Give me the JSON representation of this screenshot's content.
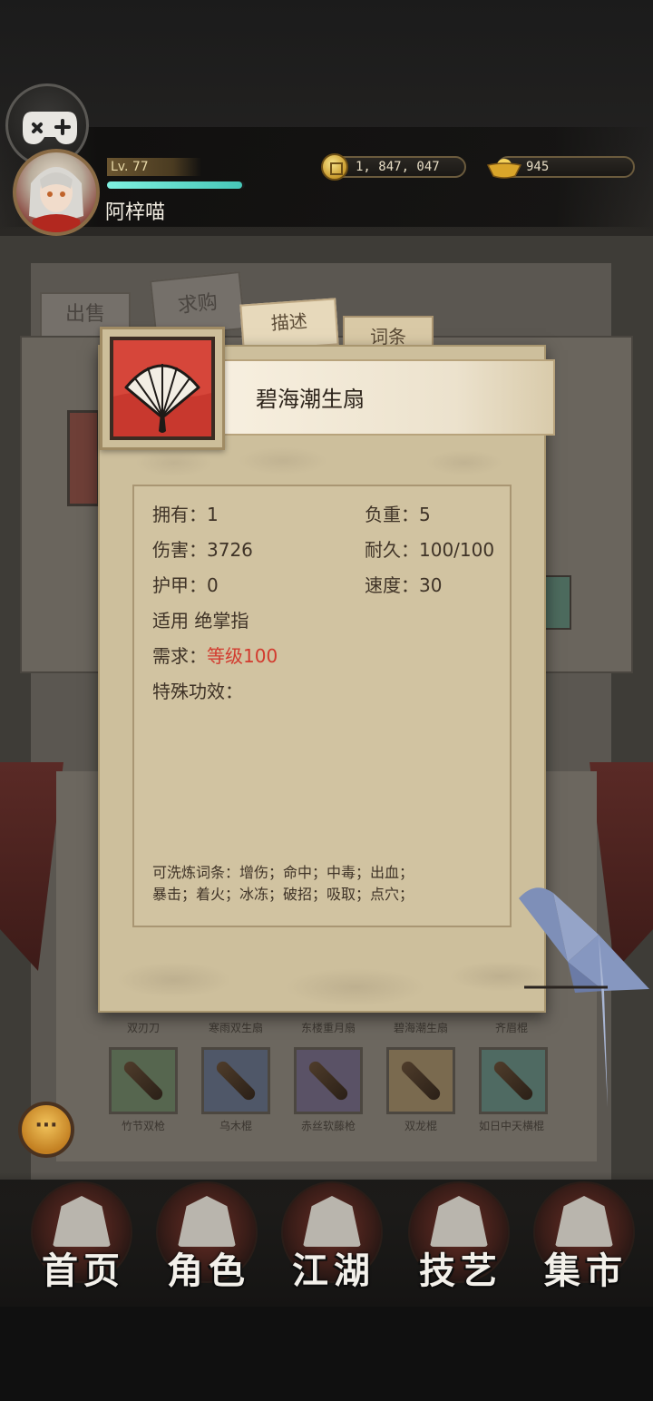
{
  "player": {
    "level": "Lv. 77",
    "name": "阿梓喵",
    "exp_fraction": 0.98
  },
  "currency": {
    "coins": "1, 847, 047",
    "ingots": "945"
  },
  "background": {
    "tab_sell": "出售",
    "tab_buy": "求购",
    "slot_names_top": [
      "双刃刀",
      "寒雨双生扇",
      "东楼重月扇",
      "碧海潮生扇",
      "齐眉棍"
    ],
    "slot_names_bottom": [
      "竹节双枪",
      "乌木棍",
      "赤丝软藤枪",
      "双龙棍",
      "如日中天横棍"
    ]
  },
  "card": {
    "tabs": [
      "描述",
      "词条"
    ],
    "item_name": "碧海潮生扇",
    "stats": {
      "own_label": "拥有：",
      "own_value": "1",
      "weight_label": "负重：",
      "weight_value": "5",
      "damage_label": "伤害：",
      "damage_value": "3726",
      "durability_label": "耐久：",
      "durability_value": "100/100",
      "armor_label": "护甲：",
      "armor_value": "0",
      "speed_label": "速度：",
      "speed_value": "30",
      "apply_label": "适用",
      "apply_value": "绝掌指",
      "req_label": "需求：",
      "req_value": "等级100",
      "special_label": "特殊功效："
    },
    "refine_line1": "可洗炼词条：增伤；命中；中毒；出血；",
    "refine_line2": "暴击；着火；冰冻；破招；吸取；点穴；"
  },
  "nav": [
    "首页",
    "角色",
    "江湖",
    "技艺",
    "集市"
  ],
  "icons": {
    "gamepad": "gamepad-icon",
    "coin": "coin-icon",
    "ingot": "ingot-icon",
    "chat": "chat-bubble-icon",
    "item": "folding-fan-icon"
  },
  "colors": {
    "exp_bar": "#47c7b8",
    "requirement_red": "#d23a2e",
    "card_paper": "#cdbf9c"
  }
}
